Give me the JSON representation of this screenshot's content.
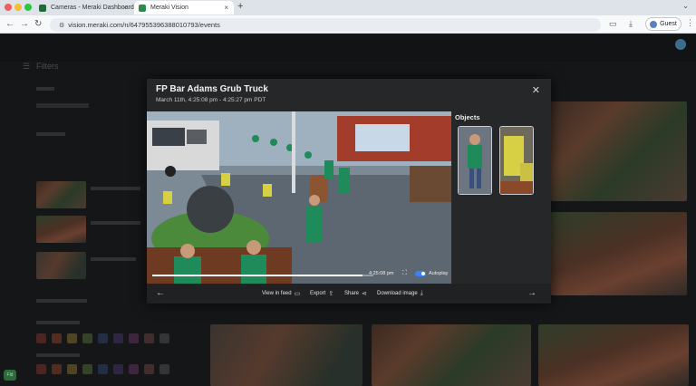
{
  "browser": {
    "tabs": [
      {
        "label": "Cameras - Meraki Dashboard",
        "active": false
      },
      {
        "label": "Meraki Vision",
        "active": true
      }
    ],
    "new_tab": "+",
    "url": "vision.meraki.com/n/647955396388010793/events",
    "profile_label": "Guest"
  },
  "app": {
    "filters_title": "Filters",
    "guest_badge": "Fld",
    "swatch_colors": [
      "#8a3a2c",
      "#9a4a2a",
      "#9a7a3a",
      "#5a7a3a",
      "#3a4a7a",
      "#4a3a7a",
      "#6a3a6a",
      "#7a4a4a",
      "#5a5a5a"
    ]
  },
  "modal": {
    "title": "FP Bar Adams Grub Truck",
    "subtitle": "March 11th, 4:25:08 pm - 4:25:27 pm PDT",
    "objects_title": "Objects",
    "video": {
      "timestamp": "4:25:08 pm",
      "autoplay_label": "Autoplay",
      "progress_pct": 95
    },
    "actions": {
      "view_in_feed": "View in feed",
      "export": "Export",
      "share": "Share",
      "download_image": "Download image"
    }
  },
  "colors": {
    "accent": "#3b82f6",
    "modal_bg": "#262729",
    "shirt_green": "#1f8a5a"
  }
}
